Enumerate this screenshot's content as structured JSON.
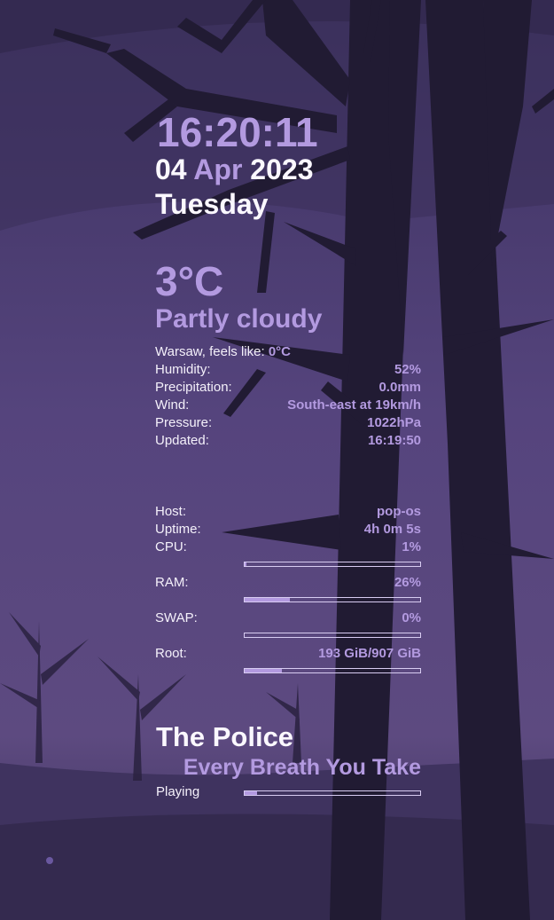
{
  "clock": {
    "time": "16:20:11",
    "day": "04",
    "month": "Apr",
    "year": "2023",
    "weekday": "Tuesday"
  },
  "weather": {
    "temperature": "3°C",
    "condition": "Partly cloudy",
    "location_label": "Warsaw, feels like:",
    "feels_like": "0°C",
    "rows": [
      {
        "label": "Humidity:",
        "value": "52%"
      },
      {
        "label": "Precipitation:",
        "value": "0.0mm"
      },
      {
        "label": "Wind:",
        "value": "South-east at 19km/h"
      },
      {
        "label": "Pressure:",
        "value": "1022hPa"
      },
      {
        "label": "Updated:",
        "value": "16:19:50"
      }
    ]
  },
  "system": {
    "host": {
      "label": "Host:",
      "value": "pop-os"
    },
    "uptime": {
      "label": "Uptime:",
      "value": "4h 0m 5s"
    },
    "cpu": {
      "label": "CPU:",
      "value": "1%",
      "fraction": 0.01
    },
    "ram": {
      "label": "RAM:",
      "value": "26%",
      "fraction": 0.26
    },
    "swap": {
      "label": "SWAP:",
      "value": "0%",
      "fraction": 0.0
    },
    "root": {
      "label": "Root:",
      "value": "193 GiB/907 GiB",
      "fraction": 0.21
    }
  },
  "music": {
    "artist": "The Police",
    "track": "Every Breath You Take",
    "status": "Playing",
    "progress": 0.07
  },
  "colors": {
    "accent": "#b39ae0",
    "text": "#fbf8ff",
    "background": "#4a3a6e",
    "tree": "#1f1a30"
  }
}
